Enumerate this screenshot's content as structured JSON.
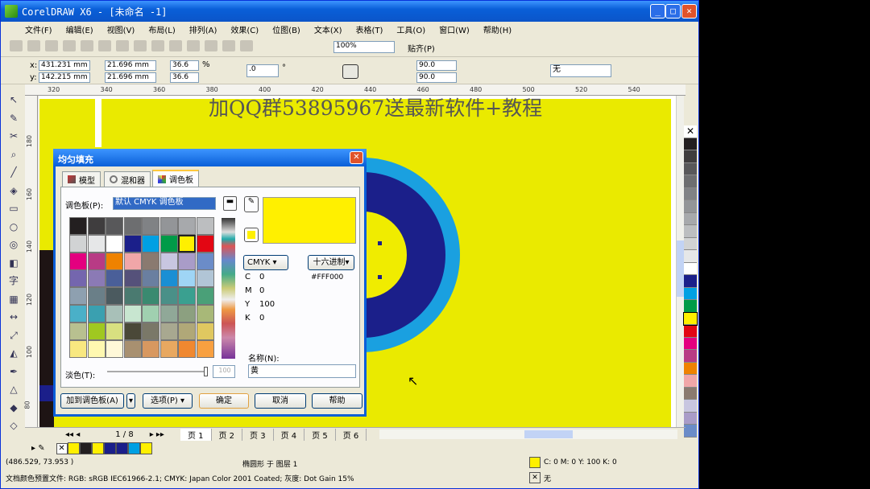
{
  "window": {
    "title": "CorelDRAW X6 - [未命名 -1]",
    "min": "_",
    "max": "□",
    "close": "✕"
  },
  "menu": [
    "文件(F)",
    "编辑(E)",
    "视图(V)",
    "布局(L)",
    "排列(A)",
    "效果(C)",
    "位图(B)",
    "文本(X)",
    "表格(T)",
    "工具(O)",
    "窗口(W)",
    "帮助(H)"
  ],
  "toolbar": {
    "zoom": "100%",
    "snap": "贴齐(P)"
  },
  "props": {
    "x": "431.231 mm",
    "y": "142.215 mm",
    "w": "21.696 mm",
    "h": "21.696 mm",
    "sx": "36.6",
    "sy": "36.6",
    "pct": "%",
    "rot": ".0",
    "deg": "°",
    "a1": "90.0",
    "a2": "90.0",
    "outline": "无",
    "xl": "x:",
    "yl": "y:"
  },
  "ruler_top": [
    "320",
    "340",
    "360",
    "380",
    "400",
    "420",
    "440",
    "460",
    "480",
    "500",
    "520",
    "540"
  ],
  "ruler_left": [
    "180",
    "160",
    "140",
    "120",
    "100",
    "80"
  ],
  "watermark": "加QQ群53895967送最新软件+教程",
  "dialog": {
    "title": "均匀填充",
    "tabs": [
      "模型",
      "混和器",
      "调色板"
    ],
    "palette_label": "调色板(P):",
    "palette_value": "默认 CMYK 调色板",
    "model": "CMYK",
    "hex_btn": "十六进制",
    "hex": "#FFF000",
    "cmyk": [
      {
        "k": "C",
        "v": "0"
      },
      {
        "k": "M",
        "v": "0"
      },
      {
        "k": "Y",
        "v": "100"
      },
      {
        "k": "K",
        "v": "0"
      }
    ],
    "tint_label": "淡色(T):",
    "tint_value": "100",
    "name_label": "名称(N):",
    "name_value": "黄",
    "selected_color": "#fff000",
    "buttons": {
      "add": "加到调色板(A)",
      "options": "选项(P)",
      "ok": "确定",
      "cancel": "取消",
      "help": "帮助"
    },
    "swatches": [
      [
        "#231f20",
        "#3f3d3e",
        "#58585a",
        "#6d6e70",
        "#808285",
        "#939598",
        "#a7a9ac",
        "#bcbec0"
      ],
      [
        "#d1d3d4",
        "#e6e7e8",
        "#ffffff",
        "#1b1f8a",
        "#00a0e3",
        "#009b48",
        "#fff000",
        "#e30613"
      ],
      [
        "#e4007f",
        "#b83b85",
        "#ef8200",
        "#f0a6a8",
        "#8a7a70",
        "#c8c6e0",
        "#a99cc8",
        "#6b8cc8"
      ],
      [
        "#7466ae",
        "#8b7ab5",
        "#4a5f99",
        "#55517a",
        "#6a7fa0",
        "#1a8fd4",
        "#9fd5f5",
        "#b1c5d6"
      ],
      [
        "#8ea0b0",
        "#6a7f88",
        "#4b5a5f",
        "#4a7a70",
        "#3a8a70",
        "#4a9088",
        "#3aa090",
        "#4aa078"
      ],
      [
        "#4ab0c8",
        "#3aa0b0",
        "#a8c0b8",
        "#c8e6d0",
        "#a0d0b0",
        "#90a898",
        "#8ca080",
        "#a8b878"
      ],
      [
        "#b8c090",
        "#a0c820",
        "#d8e080",
        "#4a4838",
        "#7a7868",
        "#a8a890",
        "#b0a878",
        "#e0c860"
      ],
      [
        "#f8e880",
        "#fff8b0",
        "#fff8d8",
        "#a89070",
        "#d89860",
        "#e8a860",
        "#f08830",
        "#f8a040"
      ]
    ]
  },
  "pages": {
    "counter": "1 / 8",
    "tabs": [
      "页 1",
      "页 2",
      "页 3",
      "页 4",
      "页 5",
      "页 6"
    ]
  },
  "doc_palette": [
    "#fff000",
    "#231f20",
    "#fff000",
    "#1b1f8a",
    "#1b1f8a",
    "#00a0e3",
    "#fff000"
  ],
  "side_palette": [
    "#231f20",
    "#3f3d3e",
    "#58585a",
    "#6d6e70",
    "#808285",
    "#939598",
    "#a7a9ac",
    "#bcbec0",
    "#d1d3d4",
    "#e6e7e8",
    "#ffffff",
    "#1b1f8a",
    "#00a0e3",
    "#009b48",
    "#fff000",
    "#e30613",
    "#e4007f",
    "#b83b85",
    "#ef8200",
    "#f0a6a8",
    "#8a7a70",
    "#c8c6e0",
    "#a99cc8",
    "#6b8cc8"
  ],
  "status": {
    "coords": "(486.529, 73.953 )",
    "object": "椭圆形 于 图层 1",
    "fill": "C: 0 M: 0 Y: 100 K: 0",
    "outline": "无",
    "profile": "文档颜色预置文件: RGB: sRGB IEC61966-2.1; CMYK: Japan Color 2001 Coated; 灰度: Dot Gain 15%"
  }
}
